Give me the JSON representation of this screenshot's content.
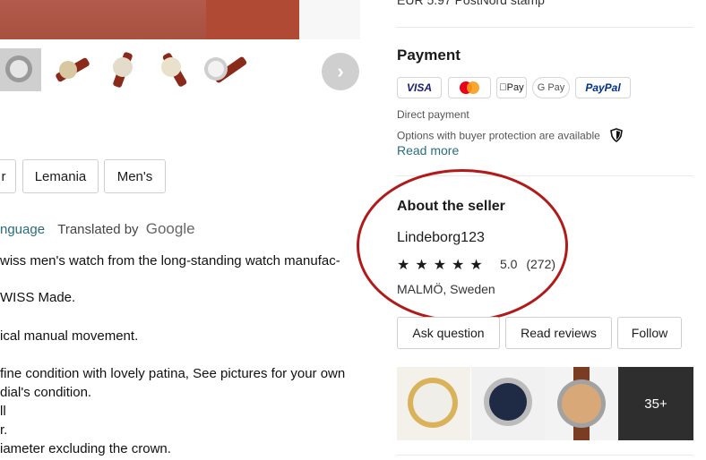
{
  "shipping": {
    "partial_text": "EUR 5.97 PostNord stamp"
  },
  "gallery": {
    "next_label": "›"
  },
  "tags": [
    "r",
    "Lemania",
    "Men's"
  ],
  "language": {
    "link": "nguage",
    "translated": "Translated by",
    "provider": "Google"
  },
  "description_lines": [
    "wiss men's watch from the long-standing watch manufac-",
    "WISS Made.",
    "ical manual movement.",
    "fine condition with lovely patina, See pictures for your own",
    "dial's condition.",
    "ll",
    "r.",
    "iameter excluding the crown."
  ],
  "payment": {
    "title": "Payment",
    "methods": [
      "VISA",
      "Mastercard",
      "Apple Pay",
      "G Pay",
      "PayPal"
    ],
    "direct": "Direct payment",
    "protection": "Options with buyer protection are available",
    "read_more": "Read more"
  },
  "seller": {
    "title": "About the seller",
    "name": "Lindeborg123",
    "stars": "★★★★★",
    "rating": "5.0",
    "reviews_count": "(272)",
    "location": "MALMÖ, Sweden"
  },
  "actions": {
    "ask": "Ask question",
    "reviews": "Read reviews",
    "follow": "Follow"
  },
  "more_items": {
    "label": "35+"
  },
  "colors": {
    "accent_link": "#2a6c7c",
    "annotation_red": "#b21a1a"
  }
}
